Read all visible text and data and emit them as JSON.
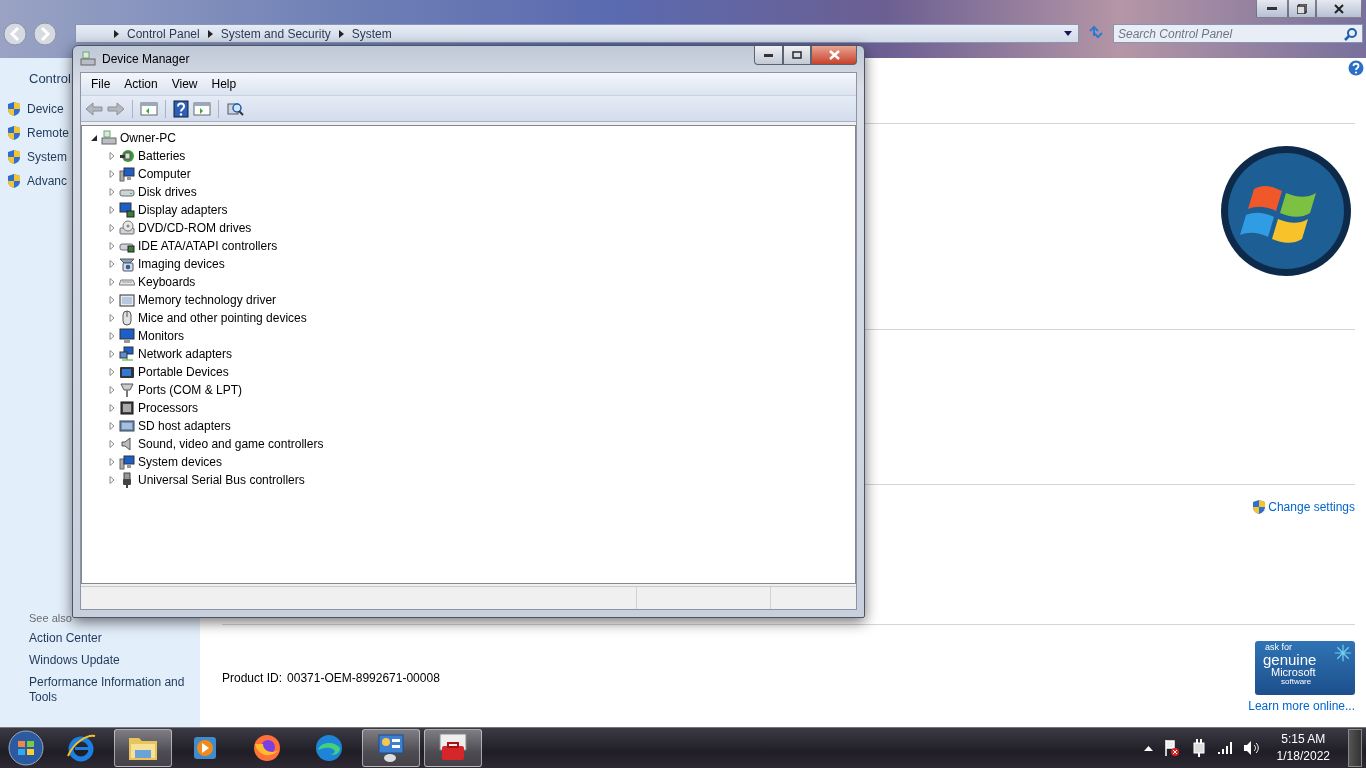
{
  "control_panel": {
    "breadcrumb": [
      "Control Panel",
      "System and Security",
      "System"
    ],
    "search": {
      "placeholder": "Search Control Panel"
    },
    "sidebar": {
      "title": "Control",
      "links": [
        "Device",
        "Remote",
        "System",
        "Advanc"
      ],
      "see_also_title": "See also",
      "see_also": [
        "Action Center",
        "Windows Update",
        "Performance Information and Tools"
      ]
    },
    "change_settings": "Change settings",
    "genuine_badge": [
      "ask for",
      "genuine",
      "Microsoft",
      "software"
    ],
    "learn_more": "Learn more online...",
    "product_id": {
      "label": "Product ID:",
      "value": "00371-OEM-8992671-00008"
    }
  },
  "device_manager": {
    "title": "Device Manager",
    "menu": [
      "File",
      "Action",
      "View",
      "Help"
    ],
    "tree": {
      "label": "Owner-PC",
      "kind": "pc",
      "expanded": true,
      "children": [
        {
          "label": "Batteries",
          "kind": "battery",
          "expanded": false
        },
        {
          "label": "Computer",
          "kind": "computer",
          "expanded": false
        },
        {
          "label": "Disk drives",
          "kind": "disk",
          "expanded": false
        },
        {
          "label": "Display adapters",
          "kind": "display",
          "expanded": false
        },
        {
          "label": "DVD/CD-ROM drives",
          "kind": "dvd",
          "expanded": false
        },
        {
          "label": "IDE ATA/ATAPI controllers",
          "kind": "ide",
          "expanded": false
        },
        {
          "label": "Imaging devices",
          "kind": "imaging",
          "expanded": false
        },
        {
          "label": "Keyboards",
          "kind": "keyboard",
          "expanded": false
        },
        {
          "label": "Memory technology driver",
          "kind": "memory",
          "expanded": false
        },
        {
          "label": "Mice and other pointing devices",
          "kind": "mouse",
          "expanded": false
        },
        {
          "label": "Monitors",
          "kind": "monitor",
          "expanded": false
        },
        {
          "label": "Network adapters",
          "kind": "network",
          "expanded": false
        },
        {
          "label": "Portable Devices",
          "kind": "portable",
          "expanded": false
        },
        {
          "label": "Ports (COM & LPT)",
          "kind": "port",
          "expanded": false
        },
        {
          "label": "Processors",
          "kind": "processor",
          "expanded": false
        },
        {
          "label": "SD host adapters",
          "kind": "sd",
          "expanded": false
        },
        {
          "label": "Sound, video and game controllers",
          "kind": "sound",
          "expanded": false
        },
        {
          "label": "System devices",
          "kind": "computer",
          "expanded": false
        },
        {
          "label": "Universal Serial Bus controllers",
          "kind": "usb",
          "expanded": false
        }
      ]
    }
  },
  "taskbar": {
    "apps": [
      {
        "kind": "ie",
        "running": false
      },
      {
        "kind": "folder",
        "running": true
      },
      {
        "kind": "player",
        "running": false
      },
      {
        "kind": "firefox",
        "running": false
      },
      {
        "kind": "edge",
        "running": false
      },
      {
        "kind": "panel",
        "running": true
      },
      {
        "kind": "toolbox",
        "running": true
      }
    ],
    "clock": {
      "time": "5:15 AM",
      "date": "1/18/2022"
    }
  }
}
